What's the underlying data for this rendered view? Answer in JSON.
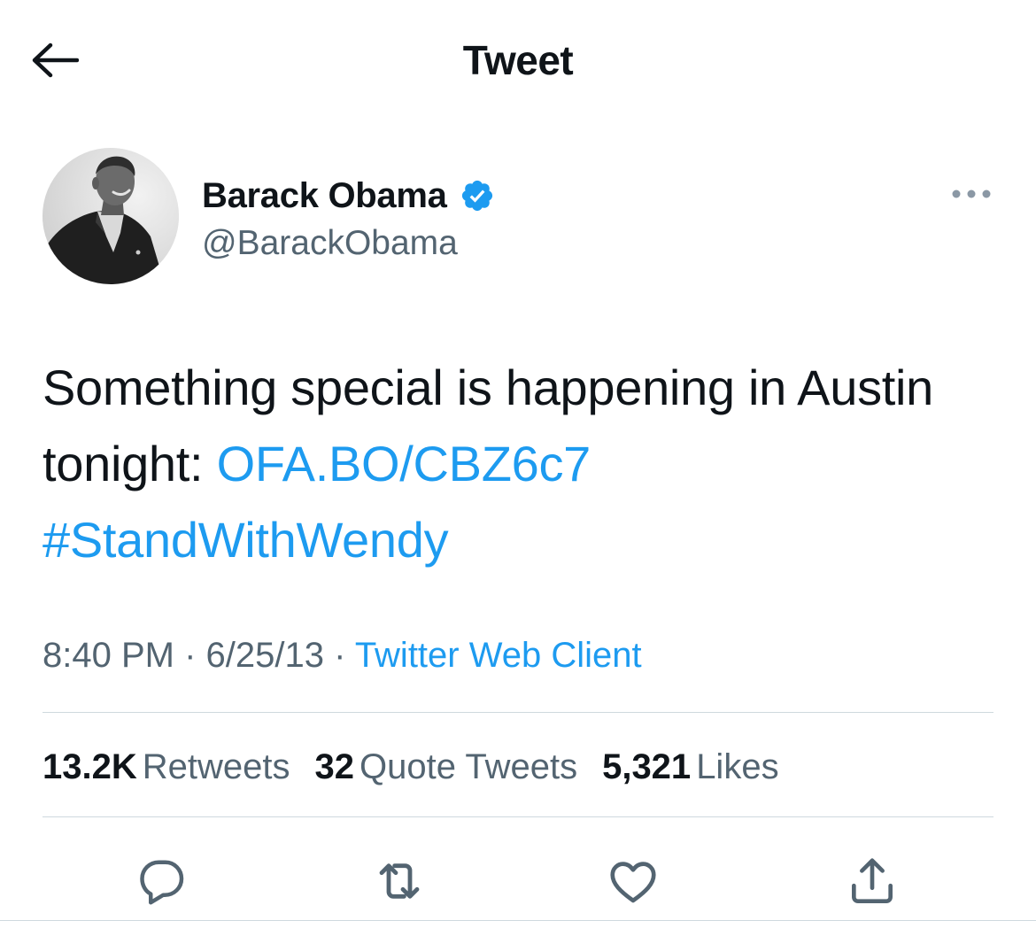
{
  "header": {
    "title": "Tweet",
    "back_icon": "arrow-left-icon"
  },
  "author": {
    "display_name": "Barack Obama",
    "handle": "@BarackObama",
    "verified": true,
    "verified_color": "#1d9bf0",
    "avatar_icon": "profile-photo"
  },
  "tweet": {
    "text_part1": "Something special is happening in Austin tonight: ",
    "link": "OFA.BO/CBZ6c7",
    "hashtag": "#StandWithWendy"
  },
  "meta": {
    "time": "8:40 PM",
    "separator": " · ",
    "date": "6/25/13",
    "source": "Twitter Web Client"
  },
  "stats": {
    "retweets_count": "13.2K",
    "retweets_label": "Retweets",
    "quotes_count": "32",
    "quotes_label": "Quote Tweets",
    "likes_count": "5,321",
    "likes_label": "Likes"
  },
  "actions": [
    "reply-icon",
    "retweet-icon",
    "like-icon",
    "share-icon"
  ],
  "colors": {
    "text": "#0f1419",
    "secondary": "#536471",
    "accent": "#1d9bf0",
    "divider": "#cfd9de"
  }
}
